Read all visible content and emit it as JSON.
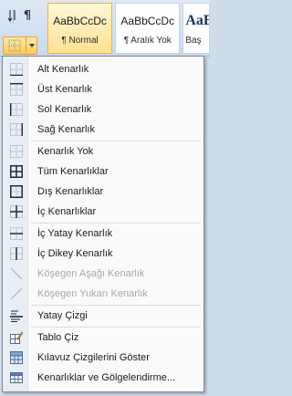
{
  "ribbon": {
    "sort_icon": "sort-icon",
    "pilcrow": "¶",
    "borders_icon": "borders-icon",
    "styles": [
      {
        "sample": "AaBbCcDc",
        "name": "¶ Normal",
        "selected": true
      },
      {
        "sample": "AaBbCcDc",
        "name": "¶ Aralık Yok",
        "selected": false
      },
      {
        "sample": "AaBl",
        "name": "Baş",
        "selected": false
      }
    ]
  },
  "menu": {
    "items": [
      {
        "label": "Alt Kenarlık",
        "icon": "bottom-border-icon",
        "enabled": true
      },
      {
        "label": "Üst Kenarlık",
        "icon": "top-border-icon",
        "enabled": true
      },
      {
        "label": "Sol Kenarlık",
        "icon": "left-border-icon",
        "enabled": true
      },
      {
        "label": "Sağ Kenarlık",
        "icon": "right-border-icon",
        "enabled": true
      },
      {
        "label": "Kenarlık Yok",
        "icon": "no-border-icon",
        "enabled": true
      },
      {
        "label": "Tüm Kenarlıklar",
        "icon": "all-borders-icon",
        "enabled": true
      },
      {
        "label": "Dış Kenarlıklar",
        "icon": "outside-borders-icon",
        "enabled": true
      },
      {
        "label": "İç Kenarlıklar",
        "icon": "inside-borders-icon",
        "enabled": true
      },
      {
        "label": "İç Yatay Kenarlık",
        "icon": "inside-horizontal-border-icon",
        "enabled": true
      },
      {
        "label": "İç Dikey Kenarlık",
        "icon": "inside-vertical-border-icon",
        "enabled": true
      },
      {
        "label": "Köşegen Aşağı Kenarlık",
        "icon": "diagonal-down-border-icon",
        "enabled": false
      },
      {
        "label": "Köşegen Yukarı Kenarlık",
        "icon": "diagonal-up-border-icon",
        "enabled": false
      },
      {
        "label": "Yatay Çizgi",
        "icon": "horizontal-line-icon",
        "enabled": true
      },
      {
        "label": "Tablo Çiz",
        "icon": "draw-table-icon",
        "enabled": true
      },
      {
        "label": "Kılavuz Çizgilerini Göster",
        "icon": "view-gridlines-icon",
        "enabled": true
      },
      {
        "label": "Kenarlıklar ve Gölgelendirme...",
        "icon": "borders-shading-icon",
        "enabled": true
      }
    ]
  }
}
